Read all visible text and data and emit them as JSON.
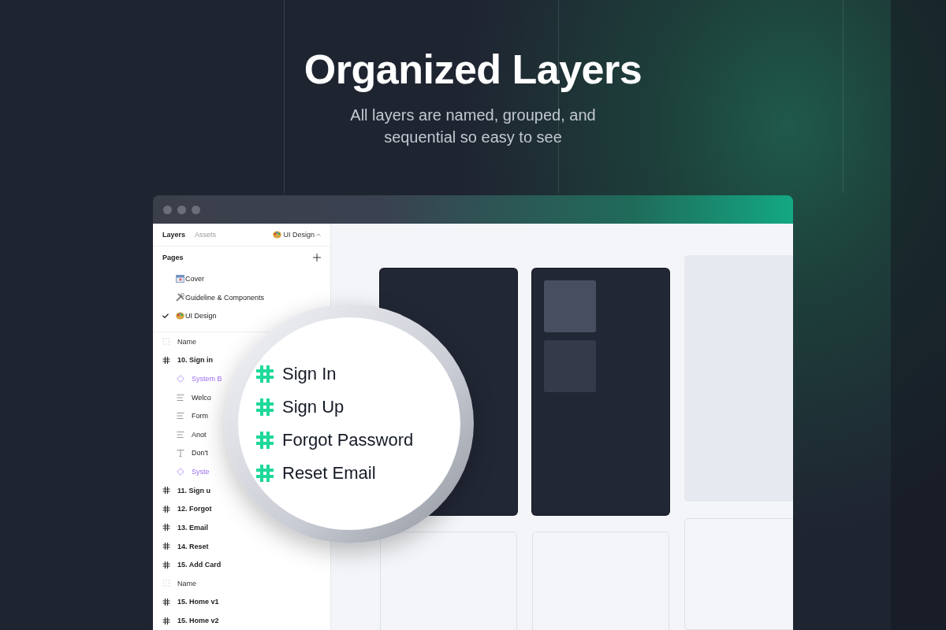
{
  "header": {
    "title": "Organized Layers",
    "subtitle": "All layers are named, grouped, and sequential so easy to see"
  },
  "panel": {
    "tabs": [
      {
        "label": "Layers",
        "selected": true
      },
      {
        "label": "Assets",
        "selected": false
      }
    ],
    "page_switcher": "UI Design",
    "pages_title": "Pages",
    "pages": [
      {
        "label": "Cover",
        "selected": false
      },
      {
        "label": "Guideline & Components",
        "selected": false
      },
      {
        "label": "UI Design",
        "selected": true
      }
    ],
    "layers": [
      {
        "kind": "header",
        "label": "Name"
      },
      {
        "kind": "frame",
        "label": "10. Sign in",
        "children": [
          {
            "kind": "component",
            "label": "System B"
          },
          {
            "kind": "paragraph",
            "label": "Welco"
          },
          {
            "kind": "paragraph",
            "label": "Form"
          },
          {
            "kind": "paragraph",
            "label": "Anot"
          },
          {
            "kind": "text",
            "label": "Don't"
          },
          {
            "kind": "component",
            "label": "Syste"
          }
        ]
      },
      {
        "kind": "frame",
        "label": "11. Sign u"
      },
      {
        "kind": "frame",
        "label": "12. Forgot"
      },
      {
        "kind": "frame",
        "label": "13. Email"
      },
      {
        "kind": "frame",
        "label": "14. Reset"
      },
      {
        "kind": "frame",
        "label": "15. Add Card"
      },
      {
        "kind": "header",
        "label": "Name"
      },
      {
        "kind": "frame",
        "label": "15. Home v1"
      },
      {
        "kind": "frame",
        "label": "15. Home v2"
      }
    ]
  },
  "magnifier": {
    "items": [
      "Sign In",
      "Sign Up",
      "Forgot Password",
      "Reset Email"
    ]
  }
}
